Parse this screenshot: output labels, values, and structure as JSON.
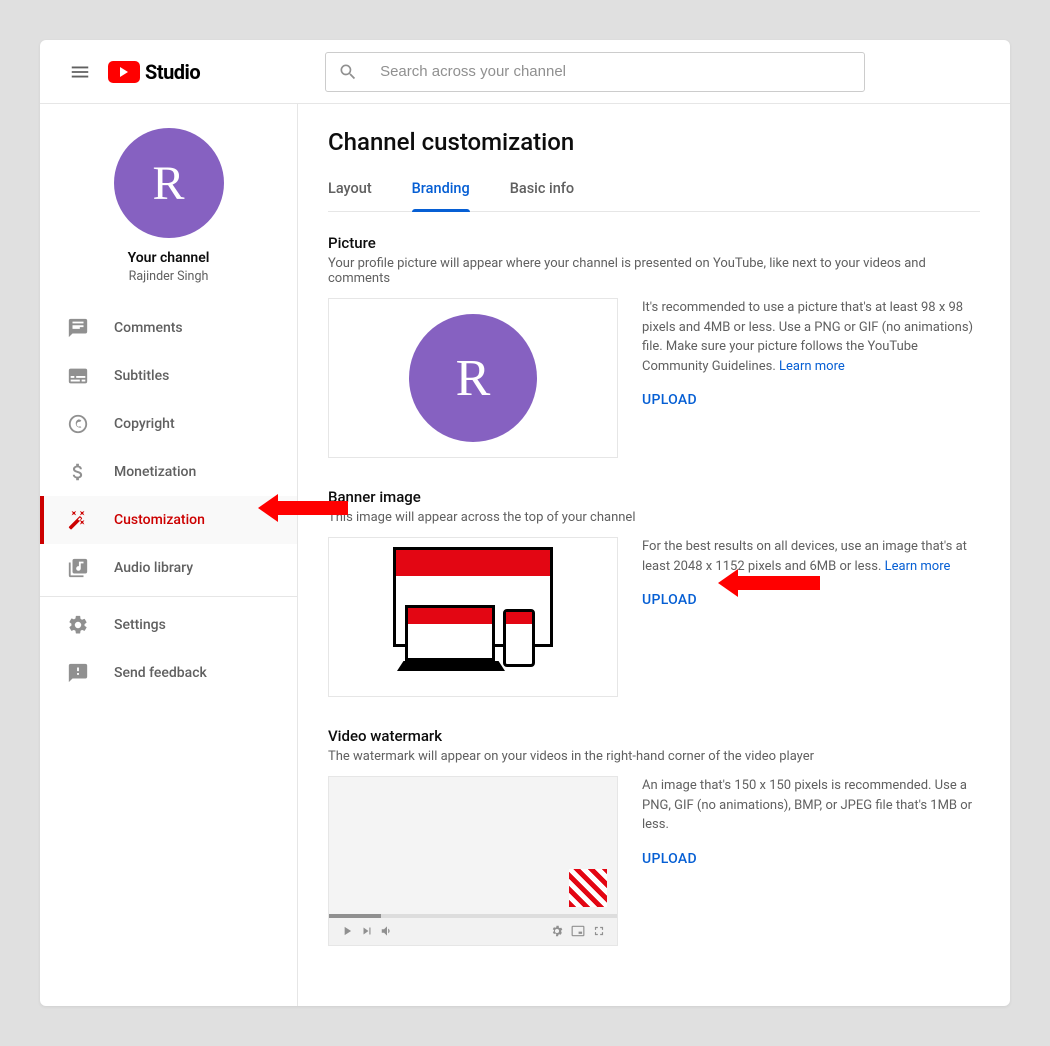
{
  "header": {
    "logo_text": "Studio",
    "search_placeholder": "Search across your channel"
  },
  "sidebar": {
    "avatar_letter": "R",
    "channel_label": "Your channel",
    "channel_name": "Rajinder Singh",
    "items": [
      {
        "label": "Comments"
      },
      {
        "label": "Subtitles"
      },
      {
        "label": "Copyright"
      },
      {
        "label": "Monetization"
      },
      {
        "label": "Customization"
      },
      {
        "label": "Audio library"
      }
    ],
    "footer": [
      {
        "label": "Settings"
      },
      {
        "label": "Send feedback"
      }
    ]
  },
  "page": {
    "title": "Channel customization",
    "tabs": [
      {
        "label": "Layout"
      },
      {
        "label": "Branding"
      },
      {
        "label": "Basic info"
      }
    ]
  },
  "picture": {
    "title": "Picture",
    "desc": "Your profile picture will appear where your channel is presented on YouTube, like next to your videos and comments",
    "hint": "It's recommended to use a picture that's at least 98 x 98 pixels and 4MB or less. Use a PNG or GIF (no animations) file. Make sure your picture follows the YouTube Community Guidelines. ",
    "learn": "Learn more",
    "upload": "UPLOAD",
    "avatar_letter": "R"
  },
  "banner": {
    "title": "Banner image",
    "desc": "This image will appear across the top of your channel",
    "hint": "For the best results on all devices, use an image that's at least 2048 x 1152 pixels and 6MB or less. ",
    "learn": "Learn more",
    "upload": "UPLOAD"
  },
  "watermark": {
    "title": "Video watermark",
    "desc": "The watermark will appear on your videos in the right-hand corner of the video player",
    "hint": "An image that's 150 x 150 pixels is recommended. Use a PNG, GIF (no animations), BMP, or JPEG file that's 1MB or less.",
    "upload": "UPLOAD"
  }
}
